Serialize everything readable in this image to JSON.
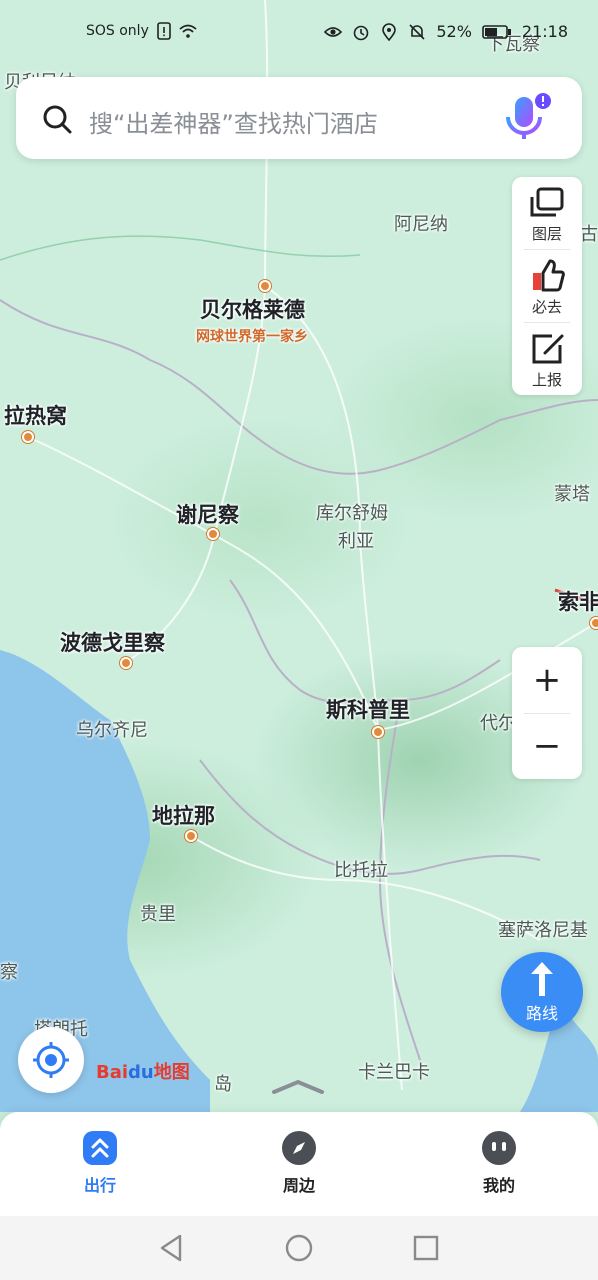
{
  "status_bar": {
    "left_text": "SOS only",
    "battery": "52%",
    "time": "21:18"
  },
  "search": {
    "placeholder": "搜“出差神器”查找热门酒店"
  },
  "side_tools": [
    {
      "label": "图层",
      "icon": "layers-icon"
    },
    {
      "label": "必去",
      "icon": "thumbs-up-icon"
    },
    {
      "label": "上报",
      "icon": "edit-report-icon"
    }
  ],
  "map": {
    "places_major": [
      "贝尔格莱德",
      "拉热窝",
      "谢尼察",
      "波德戈里察",
      "斯科普里",
      "地拉那",
      "索非"
    ],
    "places_minor": [
      "阿尼纳",
      "库尔舒姆",
      "利亚",
      "乌尔齐尼",
      "比托拉",
      "贵里",
      "塞萨洛尼基",
      "卡兰巴卡",
      "蒙塔",
      "代尔",
      "察",
      "岛",
      "塔朗托",
      "下瓦察",
      "贝利吴纳",
      "古"
    ],
    "belgrade_tag": "网球世界第一家乡"
  },
  "zoom": {
    "in": "+",
    "out": "−"
  },
  "route_button": {
    "label": "路线"
  },
  "logo": {
    "text": "Bai",
    "text_du": "du",
    "text_map": "地图"
  },
  "tabs": [
    {
      "label": "出行",
      "icon": "chevron-up-double-icon",
      "active": true
    },
    {
      "label": "周边",
      "icon": "compass-icon",
      "active": false
    },
    {
      "label": "我的",
      "icon": "profile-face-icon",
      "active": false
    }
  ],
  "colors": {
    "accent": "#2f7cf6",
    "route_blue": "#3a8df5",
    "map_land": "#cdeedd",
    "sea": "#8ec5ea",
    "city_dot": "#e2893a"
  }
}
